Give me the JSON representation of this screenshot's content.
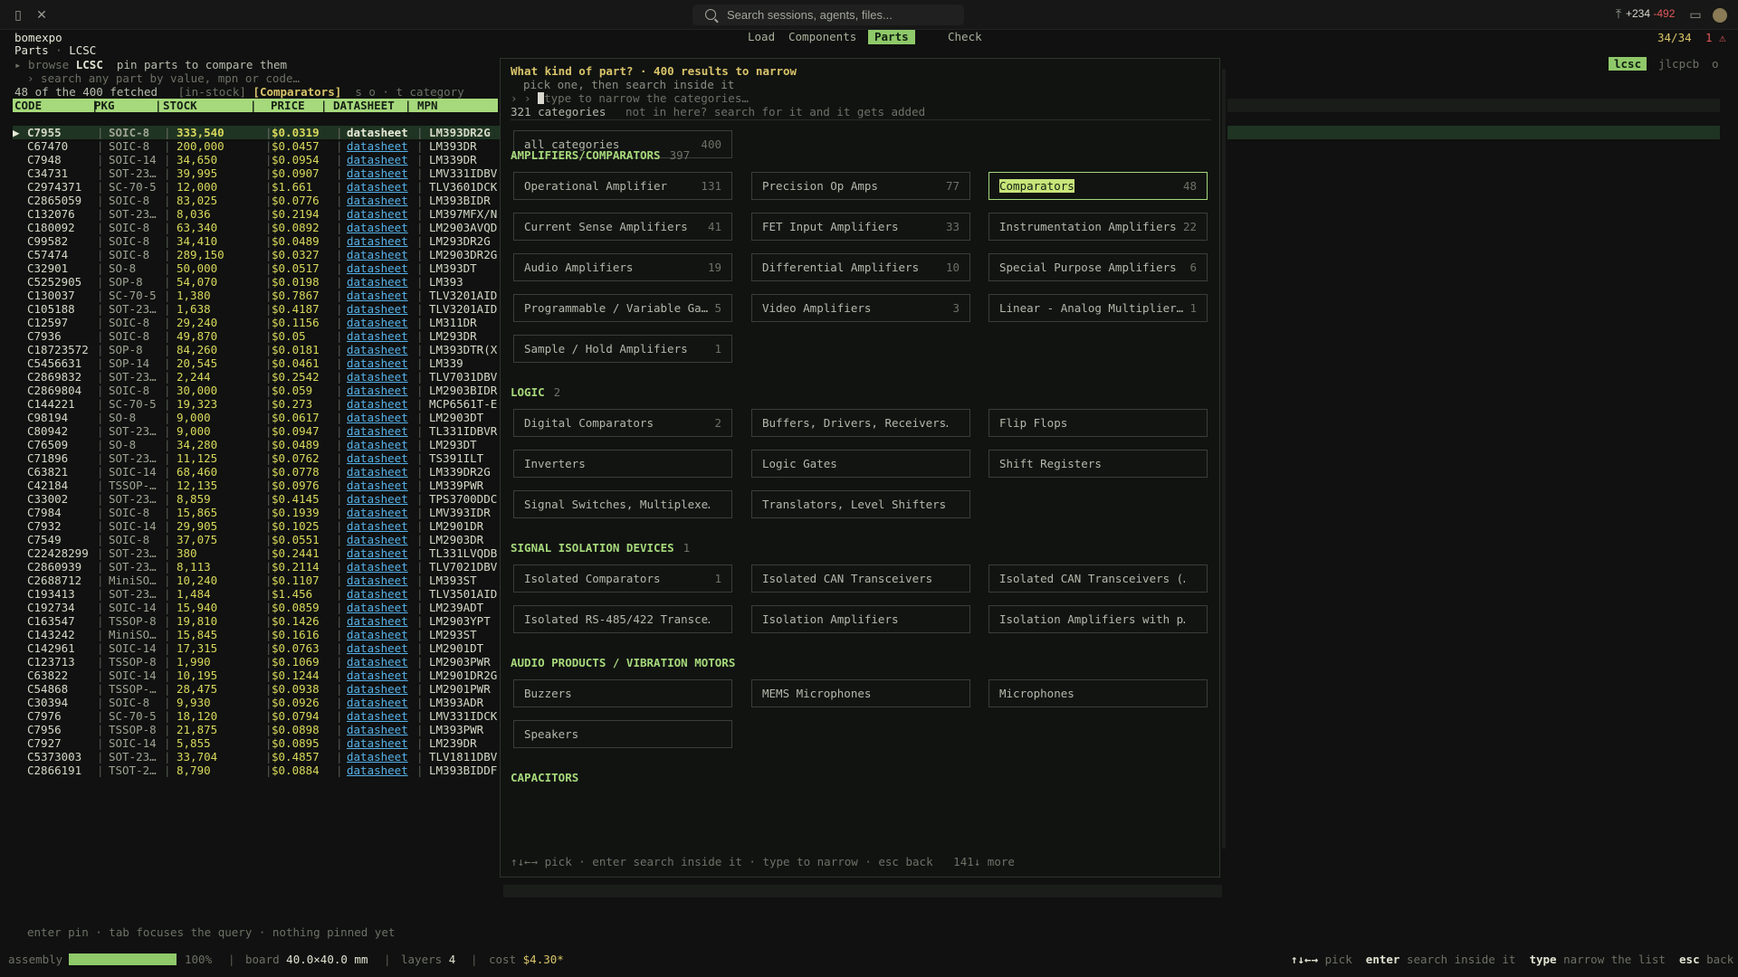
{
  "titlebar": {
    "search_placeholder": "Search sessions, agents, files...",
    "diff_plus": "+234",
    "diff_minus": "-492"
  },
  "app": {
    "name": "bomexpo",
    "nav_tabs": [
      "Load",
      "Components",
      "Parts",
      "Check"
    ],
    "active_tab": "Parts",
    "count": "34/34",
    "errors": "1"
  },
  "panel": {
    "breadcrumb_a": "Parts",
    "breadcrumb_sep": "·",
    "breadcrumb_b": "LCSC",
    "browse_prefix": "▸ browse",
    "browse_source": "LCSC",
    "browse_hint": "pin parts to compare them",
    "search_hint": "› search any part by value, mpn or code…",
    "fetched": "48 of the 400 fetched",
    "filter_stock": "[in-stock]",
    "filter_cat": "[Comparators]",
    "sort_hint": "s o · t category",
    "sources": {
      "active": "lcsc",
      "other": "jlcpcb",
      "more": "o"
    },
    "columns": [
      "CODE",
      "PKG",
      "STOCK",
      "PRICE",
      "DATASHEET",
      "MPN"
    ],
    "rows": [
      {
        "code": "C7955",
        "pkg": "SOIC-8",
        "stock": "333,540",
        "price": "$0.0319",
        "ds": "datasheet",
        "mpn": "LM393DR2G"
      },
      {
        "code": "C67470",
        "pkg": "SOIC-8",
        "stock": "200,000",
        "price": "$0.0457",
        "ds": "datasheet",
        "mpn": "LM393DR"
      },
      {
        "code": "C7948",
        "pkg": "SOIC-14",
        "stock": "34,650",
        "price": "$0.0954",
        "ds": "datasheet",
        "mpn": "LM339DR"
      },
      {
        "code": "C34731",
        "pkg": "SOT-23…",
        "stock": "39,995",
        "price": "$0.0907",
        "ds": "datasheet",
        "mpn": "LMV331IDBV"
      },
      {
        "code": "C2974371",
        "pkg": "SC-70-5",
        "stock": "12,000",
        "price": "$1.661",
        "ds": "datasheet",
        "mpn": "TLV3601DCK"
      },
      {
        "code": "C2865059",
        "pkg": "SOIC-8",
        "stock": "83,025",
        "price": "$0.0776",
        "ds": "datasheet",
        "mpn": "LM393BIDR"
      },
      {
        "code": "C132076",
        "pkg": "SOT-23…",
        "stock": "8,036",
        "price": "$0.2194",
        "ds": "datasheet",
        "mpn": "LM397MFX/N"
      },
      {
        "code": "C180092",
        "pkg": "SOIC-8",
        "stock": "63,340",
        "price": "$0.0892",
        "ds": "datasheet",
        "mpn": "LM2903AVQD"
      },
      {
        "code": "C99582",
        "pkg": "SOIC-8",
        "stock": "34,410",
        "price": "$0.0489",
        "ds": "datasheet",
        "mpn": "LM293DR2G"
      },
      {
        "code": "C57474",
        "pkg": "SOIC-8",
        "stock": "289,150",
        "price": "$0.0327",
        "ds": "datasheet",
        "mpn": "LM2903DR2G"
      },
      {
        "code": "C32901",
        "pkg": "SO-8",
        "stock": "50,000",
        "price": "$0.0517",
        "ds": "datasheet",
        "mpn": "LM393DT"
      },
      {
        "code": "C5252905",
        "pkg": "SOP-8",
        "stock": "54,070",
        "price": "$0.0198",
        "ds": "datasheet",
        "mpn": "LM393"
      },
      {
        "code": "C130037",
        "pkg": "SC-70-5",
        "stock": "1,380",
        "price": "$0.7867",
        "ds": "datasheet",
        "mpn": "TLV3201AID"
      },
      {
        "code": "C105188",
        "pkg": "SOT-23…",
        "stock": "1,638",
        "price": "$0.4187",
        "ds": "datasheet",
        "mpn": "TLV3201AID"
      },
      {
        "code": "C12597",
        "pkg": "SOIC-8",
        "stock": "29,240",
        "price": "$0.1156",
        "ds": "datasheet",
        "mpn": "LM311DR"
      },
      {
        "code": "C7936",
        "pkg": "SOIC-8",
        "stock": "49,870",
        "price": "$0.05",
        "ds": "datasheet",
        "mpn": "LM293DR"
      },
      {
        "code": "C18723572",
        "pkg": "SOP-8",
        "stock": "84,260",
        "price": "$0.0181",
        "ds": "datasheet",
        "mpn": "LM393DTR(X"
      },
      {
        "code": "C5456631",
        "pkg": "SOP-14",
        "stock": "20,545",
        "price": "$0.0461",
        "ds": "datasheet",
        "mpn": "LM339"
      },
      {
        "code": "C2869832",
        "pkg": "SOT-23…",
        "stock": "2,244",
        "price": "$0.2542",
        "ds": "datasheet",
        "mpn": "TLV7031DBV"
      },
      {
        "code": "C2869804",
        "pkg": "SOIC-8",
        "stock": "30,000",
        "price": "$0.059",
        "ds": "datasheet",
        "mpn": "LM2903BIDR"
      },
      {
        "code": "C144221",
        "pkg": "SC-70-5",
        "stock": "19,323",
        "price": "$0.273",
        "ds": "datasheet",
        "mpn": "MCP6561T-E"
      },
      {
        "code": "C98194",
        "pkg": "SO-8",
        "stock": "9,000",
        "price": "$0.0617",
        "ds": "datasheet",
        "mpn": "LM2903DT"
      },
      {
        "code": "C80942",
        "pkg": "SOT-23…",
        "stock": "9,000",
        "price": "$0.0947",
        "ds": "datasheet",
        "mpn": "TL331IDBVR"
      },
      {
        "code": "C76509",
        "pkg": "SO-8",
        "stock": "34,280",
        "price": "$0.0489",
        "ds": "datasheet",
        "mpn": "LM293DT"
      },
      {
        "code": "C71896",
        "pkg": "SOT-23…",
        "stock": "11,125",
        "price": "$0.0762",
        "ds": "datasheet",
        "mpn": "TS391ILT"
      },
      {
        "code": "C63821",
        "pkg": "SOIC-14",
        "stock": "68,460",
        "price": "$0.0778",
        "ds": "datasheet",
        "mpn": "LM339DR2G"
      },
      {
        "code": "C42184",
        "pkg": "TSSOP-…",
        "stock": "12,135",
        "price": "$0.0976",
        "ds": "datasheet",
        "mpn": "LM339PWR"
      },
      {
        "code": "C33002",
        "pkg": "SOT-23…",
        "stock": "8,859",
        "price": "$0.4145",
        "ds": "datasheet",
        "mpn": "TPS3700DDC"
      },
      {
        "code": "C7984",
        "pkg": "SOIC-8",
        "stock": "15,865",
        "price": "$0.1939",
        "ds": "datasheet",
        "mpn": "LMV393IDR"
      },
      {
        "code": "C7932",
        "pkg": "SOIC-14",
        "stock": "29,905",
        "price": "$0.1025",
        "ds": "datasheet",
        "mpn": "LM2901DR"
      },
      {
        "code": "C7549",
        "pkg": "SOIC-8",
        "stock": "37,075",
        "price": "$0.0551",
        "ds": "datasheet",
        "mpn": "LM2903DR"
      },
      {
        "code": "C22428299",
        "pkg": "SOT-23…",
        "stock": "380",
        "price": "$0.2441",
        "ds": "datasheet",
        "mpn": "TL331LVQDB"
      },
      {
        "code": "C2860939",
        "pkg": "SOT-23…",
        "stock": "8,113",
        "price": "$0.2114",
        "ds": "datasheet",
        "mpn": "TLV7021DBV"
      },
      {
        "code": "C2688712",
        "pkg": "MiniSO…",
        "stock": "10,240",
        "price": "$0.1107",
        "ds": "datasheet",
        "mpn": "LM393ST"
      },
      {
        "code": "C193413",
        "pkg": "SOT-23…",
        "stock": "1,484",
        "price": "$1.456",
        "ds": "datasheet",
        "mpn": "TLV3501AID"
      },
      {
        "code": "C192734",
        "pkg": "SOIC-14",
        "stock": "15,940",
        "price": "$0.0859",
        "ds": "datasheet",
        "mpn": "LM239ADT"
      },
      {
        "code": "C163547",
        "pkg": "TSSOP-8",
        "stock": "19,810",
        "price": "$0.1426",
        "ds": "datasheet",
        "mpn": "LM2903YPT"
      },
      {
        "code": "C143242",
        "pkg": "MiniSO…",
        "stock": "15,845",
        "price": "$0.1616",
        "ds": "datasheet",
        "mpn": "LM293ST"
      },
      {
        "code": "C142961",
        "pkg": "SOIC-14",
        "stock": "17,315",
        "price": "$0.0763",
        "ds": "datasheet",
        "mpn": "LM2901DT"
      },
      {
        "code": "C123713",
        "pkg": "TSSOP-8",
        "stock": "1,990",
        "price": "$0.1069",
        "ds": "datasheet",
        "mpn": "LM2903PWR"
      },
      {
        "code": "C63822",
        "pkg": "SOIC-14",
        "stock": "10,195",
        "price": "$0.1244",
        "ds": "datasheet",
        "mpn": "LM2901DR2G"
      },
      {
        "code": "C54868",
        "pkg": "TSSOP-…",
        "stock": "28,475",
        "price": "$0.0938",
        "ds": "datasheet",
        "mpn": "LM2901PWR"
      },
      {
        "code": "C30394",
        "pkg": "SOIC-8",
        "stock": "9,930",
        "price": "$0.0926",
        "ds": "datasheet",
        "mpn": "LM393ADR"
      },
      {
        "code": "C7976",
        "pkg": "SC-70-5",
        "stock": "18,120",
        "price": "$0.0794",
        "ds": "datasheet",
        "mpn": "LMV331IDCK"
      },
      {
        "code": "C7956",
        "pkg": "TSSOP-8",
        "stock": "21,875",
        "price": "$0.0898",
        "ds": "datasheet",
        "mpn": "LM393PWR"
      },
      {
        "code": "C7927",
        "pkg": "SOIC-14",
        "stock": "5,855",
        "price": "$0.0895",
        "ds": "datasheet",
        "mpn": "LM239DR"
      },
      {
        "code": "C5373003",
        "pkg": "SOT-23…",
        "stock": "33,704",
        "price": "$0.4857",
        "ds": "datasheet",
        "mpn": "TLV1811DBV"
      },
      {
        "code": "C2866191",
        "pkg": "TSOT-2…",
        "stock": "8,790",
        "price": "$0.0884",
        "ds": "datasheet",
        "mpn": "LM393BIDDF"
      }
    ],
    "pin_hint": "enter pin · tab focuses the query · nothing pinned yet"
  },
  "modal": {
    "title": "What kind of part? · 400 results to narrow",
    "subtitle": "pick one, then search inside it",
    "prompt": "› ›",
    "input_placeholder": "type to narrow the categories…",
    "categories_count": "321 categories",
    "not_here_hint": "not in here? search for it and it gets added",
    "all_label": "all categories",
    "all_count": "400",
    "groups": [
      {
        "name": "AMPLIFIERS/COMPARATORS",
        "count": "397",
        "items": [
          {
            "label": "Operational Amplifier",
            "count": "131"
          },
          {
            "label": "Precision Op Amps",
            "count": "77"
          },
          {
            "label": "Comparators",
            "count": "48",
            "selected": true
          },
          {
            "label": "Current Sense Amplifiers",
            "count": "41"
          },
          {
            "label": "FET Input Amplifiers",
            "count": "33"
          },
          {
            "label": "Instrumentation Amplifiers",
            "count": "22"
          },
          {
            "label": "Audio Amplifiers",
            "count": "19"
          },
          {
            "label": "Differential Amplifiers",
            "count": "10"
          },
          {
            "label": "Special Purpose Amplifiers",
            "count": "6"
          },
          {
            "label": "Programmable / Variable Ga…",
            "count": "5"
          },
          {
            "label": "Video Amplifiers",
            "count": "3"
          },
          {
            "label": "Linear - Analog Multiplier…",
            "count": "1"
          },
          {
            "label": "Sample / Hold Amplifiers",
            "count": "1"
          }
        ]
      },
      {
        "name": "LOGIC",
        "count": "2",
        "items": [
          {
            "label": "Digital Comparators",
            "count": "2"
          },
          {
            "label": "Buffers, Drivers, Receivers…",
            "count": ""
          },
          {
            "label": "Flip Flops",
            "count": ""
          },
          {
            "label": "Inverters",
            "count": ""
          },
          {
            "label": "Logic Gates",
            "count": ""
          },
          {
            "label": "Shift Registers",
            "count": ""
          },
          {
            "label": "Signal Switches, Multiplexe…",
            "count": ""
          },
          {
            "label": "Translators, Level Shifters",
            "count": ""
          }
        ]
      },
      {
        "name": "SIGNAL ISOLATION DEVICES",
        "count": "1",
        "items": [
          {
            "label": "Isolated Comparators",
            "count": "1"
          },
          {
            "label": "Isolated CAN Transceivers",
            "count": ""
          },
          {
            "label": "Isolated CAN Transceivers (…",
            "count": ""
          },
          {
            "label": "Isolated RS-485/422 Transce…",
            "count": ""
          },
          {
            "label": "Isolation Amplifiers",
            "count": ""
          },
          {
            "label": "Isolation Amplifiers with p…",
            "count": ""
          }
        ]
      },
      {
        "name": "AUDIO PRODUCTS / VIBRATION MOTORS",
        "count": "",
        "items": [
          {
            "label": "Buzzers",
            "count": ""
          },
          {
            "label": "MEMS Microphones",
            "count": ""
          },
          {
            "label": "Microphones",
            "count": ""
          },
          {
            "label": "Speakers",
            "count": ""
          }
        ]
      },
      {
        "name": "CAPACITORS",
        "count": "",
        "items": []
      }
    ],
    "footer": "↑↓←→ pick · enter search inside it · type to narrow · esc back   141↓ more"
  },
  "statusbar": {
    "assembly_label": "assembly",
    "assembly_pct": "100%",
    "assembly_progress": 1.0,
    "board_label": "board",
    "board_value": "40.0×40.0 mm",
    "layers_label": "layers",
    "layers_value": "4",
    "cost_label": "cost",
    "cost_value": "$4.30*",
    "hint_keys": [
      {
        "key": "↑↓←→",
        "desc": "pick"
      },
      {
        "key": "enter",
        "desc": "search inside it"
      },
      {
        "key": "type",
        "desc": "narrow the list"
      },
      {
        "key": "esc",
        "desc": "back"
      }
    ]
  },
  "colors": {
    "accent": "#a6d97b",
    "accent_dark": "#8fc96a",
    "link": "#56b1e8",
    "value": "#d8d85c",
    "error": "#e0585a"
  }
}
